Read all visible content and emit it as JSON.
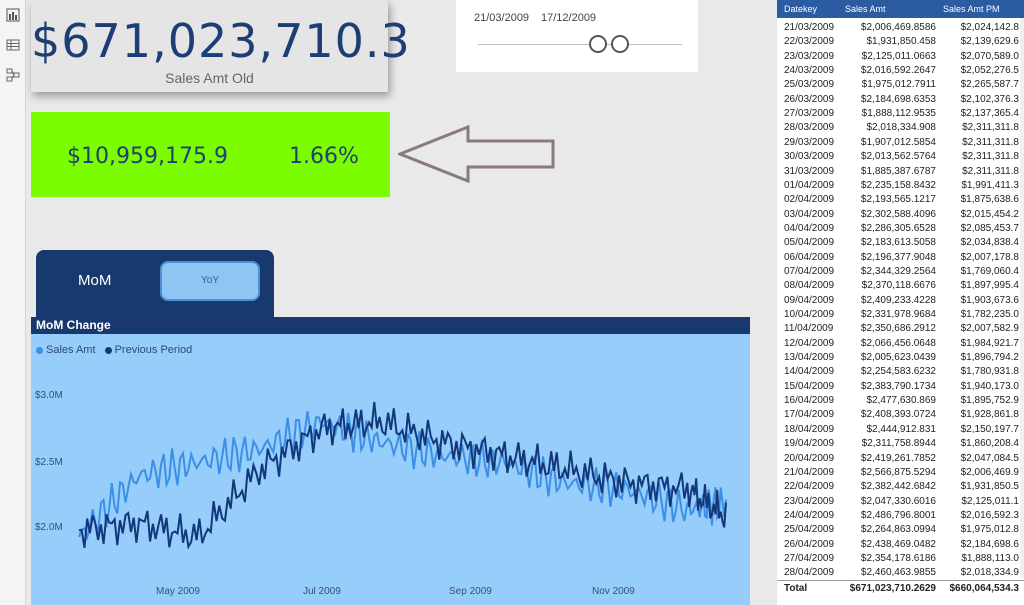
{
  "rail": {
    "icons": [
      "bar-chart-icon",
      "table-icon",
      "model-icon"
    ]
  },
  "kpi": {
    "value": "$671,023,710.3",
    "label": "Sales Amt Old"
  },
  "slicer": {
    "start": "21/03/2009",
    "end": "17/12/2009"
  },
  "variance": {
    "amount": "$10,959,175.9",
    "percent": "1.66%"
  },
  "toggle": {
    "left": "MoM",
    "right": "YoY"
  },
  "chart": {
    "title": "MoM Change",
    "legend": [
      "Sales Amt",
      "Previous Period"
    ],
    "colors": {
      "sales": "#3b8fe4",
      "prev": "#12377a"
    }
  },
  "chart_data": {
    "type": "line",
    "x": [
      "2009-03-21",
      "2009-04-15",
      "2009-05-10",
      "2009-06-05",
      "2009-07-01",
      "2009-07-25",
      "2009-08-20",
      "2009-09-15",
      "2009-10-10",
      "2009-11-05",
      "2009-12-01",
      "2009-12-17"
    ],
    "series": [
      {
        "name": "Sales Amt",
        "values": [
          2.0,
          2.45,
          2.55,
          2.65,
          2.85,
          2.7,
          2.6,
          2.55,
          2.4,
          2.35,
          2.2,
          2.25
        ]
      },
      {
        "name": "Previous Period",
        "values": [
          2.05,
          2.1,
          2.0,
          2.5,
          2.8,
          2.85,
          2.7,
          2.6,
          2.5,
          2.4,
          2.35,
          2.15
        ]
      }
    ],
    "ylabel": "",
    "yticks": [
      "$2.0M",
      "$2.5M",
      "$3.0M"
    ],
    "xticks": [
      "May 2009",
      "Jul 2009",
      "Sep 2009",
      "Nov 2009"
    ],
    "ylim": [
      1.8,
      3.2
    ]
  },
  "table": {
    "headers": [
      "Datekey",
      "Sales Amt",
      "Sales Amt PM"
    ],
    "rows": [
      [
        "21/03/2009",
        "$2,006,469.8586",
        "$2,024,142.8"
      ],
      [
        "22/03/2009",
        "$1,931,850.458",
        "$2,139,629.6"
      ],
      [
        "23/03/2009",
        "$2,125,011.0663",
        "$2,070,589.0"
      ],
      [
        "24/03/2009",
        "$2,016,592.2647",
        "$2,052,276.5"
      ],
      [
        "25/03/2009",
        "$1,975,012.7911",
        "$2,265,587.7"
      ],
      [
        "26/03/2009",
        "$2,184,698.6353",
        "$2,102,376.3"
      ],
      [
        "27/03/2009",
        "$1,888,112.9535",
        "$2,137,365.4"
      ],
      [
        "28/03/2009",
        "$2,018,334.908",
        "$2,311,311.8"
      ],
      [
        "29/03/2009",
        "$1,907,012.5854",
        "$2,311,311.8"
      ],
      [
        "30/03/2009",
        "$2,013,562.5764",
        "$2,311,311.8"
      ],
      [
        "31/03/2009",
        "$1,885,387.6787",
        "$2,311,311.8"
      ],
      [
        "01/04/2009",
        "$2,235,158.8432",
        "$1,991,411.3"
      ],
      [
        "02/04/2009",
        "$2,193,565.1217",
        "$1,875,638.6"
      ],
      [
        "03/04/2009",
        "$2,302,588.4096",
        "$2,015,454.2"
      ],
      [
        "04/04/2009",
        "$2,286,305.6528",
        "$2,085,453.7"
      ],
      [
        "05/04/2009",
        "$2,183,613.5058",
        "$2,034,838.4"
      ],
      [
        "06/04/2009",
        "$2,196,377.9048",
        "$2,007,178.8"
      ],
      [
        "07/04/2009",
        "$2,344,329.2564",
        "$1,769,060.4"
      ],
      [
        "08/04/2009",
        "$2,370,118.6676",
        "$1,897,995.4"
      ],
      [
        "09/04/2009",
        "$2,409,233.4228",
        "$1,903,673.6"
      ],
      [
        "10/04/2009",
        "$2,331,978.9684",
        "$1,782,235.0"
      ],
      [
        "11/04/2009",
        "$2,350,686.2912",
        "$2,007,582.9"
      ],
      [
        "12/04/2009",
        "$2,066,456.0648",
        "$1,984,921.7"
      ],
      [
        "13/04/2009",
        "$2,005,623.0439",
        "$1,896,794.2"
      ],
      [
        "14/04/2009",
        "$2,254,583.6232",
        "$1,780,931.8"
      ],
      [
        "15/04/2009",
        "$2,383,790.1734",
        "$1,940,173.0"
      ],
      [
        "16/04/2009",
        "$2,477,630.869",
        "$1,895,752.9"
      ],
      [
        "17/04/2009",
        "$2,408,393.0724",
        "$1,928,861.8"
      ],
      [
        "18/04/2009",
        "$2,444,912.831",
        "$2,150,197.7"
      ],
      [
        "19/04/2009",
        "$2,311,758.8944",
        "$1,860,208.4"
      ],
      [
        "20/04/2009",
        "$2,419,261.7852",
        "$2,047,084.5"
      ],
      [
        "21/04/2009",
        "$2,566,875.5294",
        "$2,006,469.9"
      ],
      [
        "22/04/2009",
        "$2,382,442.6842",
        "$1,931,850.5"
      ],
      [
        "23/04/2009",
        "$2,047,330.6016",
        "$2,125,011.1"
      ],
      [
        "24/04/2009",
        "$2,486,796.8001",
        "$2,016,592.3"
      ],
      [
        "25/04/2009",
        "$2,264,863.0994",
        "$1,975,012.8"
      ],
      [
        "26/04/2009",
        "$2,438,469.0482",
        "$2,184,698.6"
      ],
      [
        "27/04/2009",
        "$2,354,178.6186",
        "$1,888,113.0"
      ],
      [
        "28/04/2009",
        "$2,460,463.9855",
        "$2,018,334.9"
      ]
    ],
    "total": [
      "Total",
      "$671,023,710.2629",
      "$660,064,534.3"
    ]
  }
}
